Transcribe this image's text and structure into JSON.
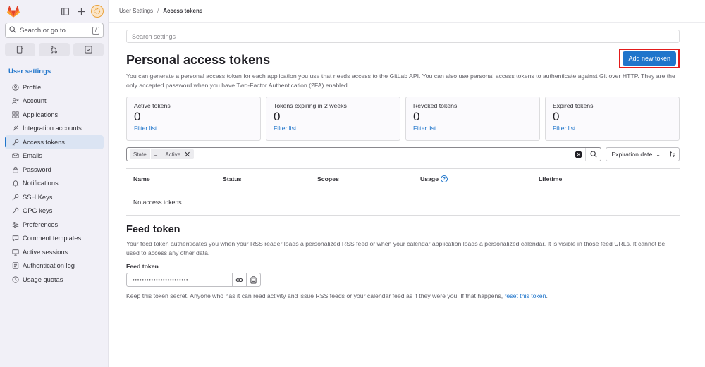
{
  "sidebar": {
    "search_placeholder": "Search or go to…",
    "search_kbd": "/",
    "heading": "User settings",
    "items": [
      {
        "label": "Profile",
        "icon": "profile-icon"
      },
      {
        "label": "Account",
        "icon": "account-icon"
      },
      {
        "label": "Applications",
        "icon": "applications-icon"
      },
      {
        "label": "Integration accounts",
        "icon": "integration-icon"
      },
      {
        "label": "Access tokens",
        "icon": "token-icon",
        "active": true
      },
      {
        "label": "Emails",
        "icon": "mail-icon"
      },
      {
        "label": "Password",
        "icon": "lock-icon"
      },
      {
        "label": "Notifications",
        "icon": "bell-icon"
      },
      {
        "label": "SSH Keys",
        "icon": "key-icon"
      },
      {
        "label": "GPG keys",
        "icon": "key-icon"
      },
      {
        "label": "Preferences",
        "icon": "preferences-icon"
      },
      {
        "label": "Comment templates",
        "icon": "comment-icon"
      },
      {
        "label": "Active sessions",
        "icon": "sessions-icon"
      },
      {
        "label": "Authentication log",
        "icon": "log-icon"
      },
      {
        "label": "Usage quotas",
        "icon": "quota-icon"
      }
    ]
  },
  "breadcrumb": {
    "parent": "User Settings",
    "separator": "/",
    "current": "Access tokens"
  },
  "search_settings_placeholder": "Search settings",
  "page": {
    "title": "Personal access tokens",
    "add_button": "Add new token",
    "description": "You can generate a personal access token for each application you use that needs access to the GitLab API. You can also use personal access tokens to authenticate against Git over HTTP. They are the only accepted password when you have Two-Factor Authentication (2FA) enabled."
  },
  "stats": [
    {
      "label": "Active tokens",
      "value": "0",
      "link": "Filter list"
    },
    {
      "label": "Tokens expiring in 2 weeks",
      "value": "0",
      "link": "Filter list"
    },
    {
      "label": "Revoked tokens",
      "value": "0",
      "link": "Filter list"
    },
    {
      "label": "Expired tokens",
      "value": "0",
      "link": "Filter list"
    }
  ],
  "filter": {
    "field": "State",
    "operator": "=",
    "value": "Active"
  },
  "sort": {
    "label": "Expiration date"
  },
  "table": {
    "headers": {
      "name": "Name",
      "status": "Status",
      "scopes": "Scopes",
      "usage": "Usage",
      "lifetime": "Lifetime"
    },
    "empty": "No access tokens"
  },
  "feed": {
    "title": "Feed token",
    "description": "Your feed token authenticates you when your RSS reader loads a personalized RSS feed or when your calendar application loads a personalized calendar. It is visible in those feed URLs. It cannot be used to access any other data.",
    "label": "Feed token",
    "masked_value": "••••••••••••••••••••••••",
    "note": "Keep this token secret. Anyone who has it can read activity and issue RSS feeds or your calendar feed as if they were you. If that happens, ",
    "note_link": "reset this token",
    "note_end": "."
  }
}
